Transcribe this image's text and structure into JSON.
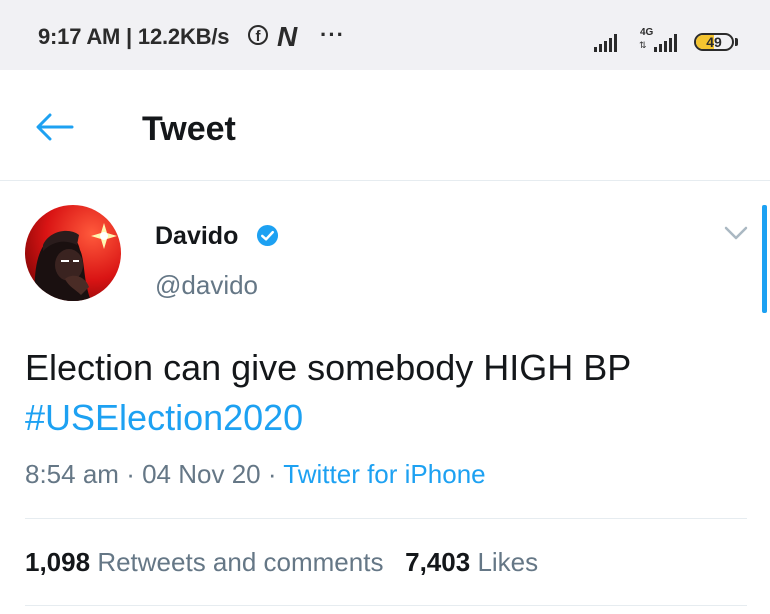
{
  "status_bar": {
    "time_speed": "9:17 AM | 12.2KB/s",
    "fb_icon_glyph": "f",
    "n_icon_glyph": "N",
    "more": "···",
    "network": "4G",
    "network_arrows": "⇅",
    "battery": "49",
    "battery_level": 0.49,
    "battery_color": "#f4c430"
  },
  "header": {
    "title": "Tweet",
    "back_icon": "arrow-left-icon",
    "accent": "#1da1f2"
  },
  "tweet": {
    "author_name": "Davido",
    "handle": "@davido",
    "text": "Election can give somebody HIGH BP",
    "hashtag": "#USElection2020",
    "time": "8:54 am",
    "date": "04 Nov 20",
    "separator": "·",
    "source": "Twitter for iPhone",
    "retweets_count": "1,098",
    "retweets_label": "Retweets and comments",
    "likes_count": "7,403",
    "likes_label": "Likes"
  }
}
